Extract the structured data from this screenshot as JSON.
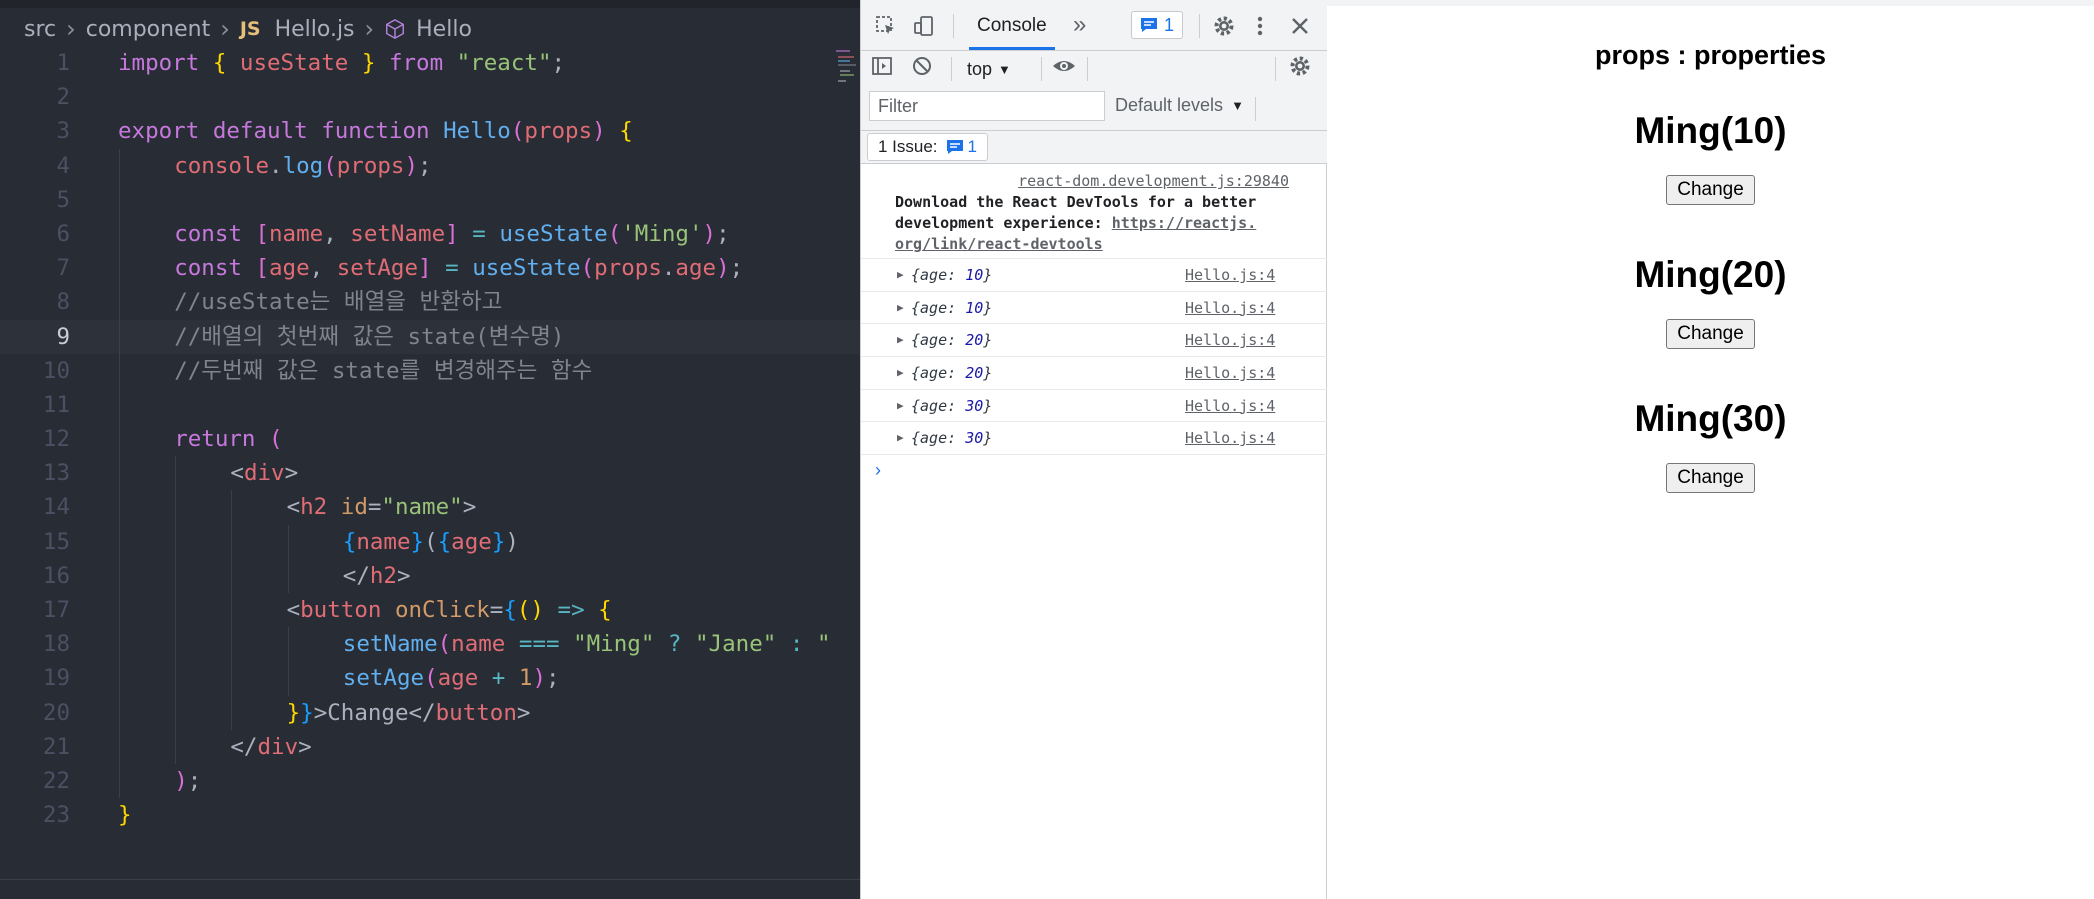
{
  "editor": {
    "breadcrumb": [
      "src",
      "component",
      "Hello.js",
      "Hello"
    ],
    "file_type_badge": "JS",
    "active_line": 9,
    "lines": [
      {
        "n": "1",
        "indent": 0,
        "tokens": [
          [
            "kw",
            "import "
          ],
          [
            "b1",
            "{ "
          ],
          [
            "var",
            "useState"
          ],
          [
            "b1",
            " } "
          ],
          [
            "kw",
            "from "
          ],
          [
            "str",
            "\"react\""
          ],
          [
            "pl",
            ";"
          ]
        ]
      },
      {
        "n": "2",
        "indent": 0,
        "tokens": []
      },
      {
        "n": "3",
        "indent": 0,
        "tokens": [
          [
            "kw",
            "export default function "
          ],
          [
            "fn",
            "Hello"
          ],
          [
            "b2",
            "("
          ],
          [
            "var",
            "props"
          ],
          [
            "b2",
            ")"
          ],
          [
            "b1",
            " {"
          ]
        ]
      },
      {
        "n": "4",
        "indent": 1,
        "tokens": [
          [
            "var",
            "console"
          ],
          [
            "pl",
            "."
          ],
          [
            "fn",
            "log"
          ],
          [
            "b2",
            "("
          ],
          [
            "var",
            "props"
          ],
          [
            "b2",
            ")"
          ],
          [
            "pl",
            ";"
          ]
        ]
      },
      {
        "n": "5",
        "indent": 1,
        "tokens": []
      },
      {
        "n": "6",
        "indent": 1,
        "tokens": [
          [
            "kw",
            "const "
          ],
          [
            "b2",
            "["
          ],
          [
            "var",
            "name"
          ],
          [
            "pl",
            ", "
          ],
          [
            "var",
            "setName"
          ],
          [
            "b2",
            "]"
          ],
          [
            "op",
            " = "
          ],
          [
            "fn",
            "useState"
          ],
          [
            "b2",
            "("
          ],
          [
            "str",
            "'Ming'"
          ],
          [
            "b2",
            ")"
          ],
          [
            "pl",
            ";"
          ]
        ]
      },
      {
        "n": "7",
        "indent": 1,
        "tokens": [
          [
            "kw",
            "const "
          ],
          [
            "b2",
            "["
          ],
          [
            "var",
            "age"
          ],
          [
            "pl",
            ", "
          ],
          [
            "var",
            "setAge"
          ],
          [
            "b2",
            "]"
          ],
          [
            "op",
            " = "
          ],
          [
            "fn",
            "useState"
          ],
          [
            "b2",
            "("
          ],
          [
            "var",
            "props"
          ],
          [
            "pl",
            "."
          ],
          [
            "var",
            "age"
          ],
          [
            "b2",
            ")"
          ],
          [
            "pl",
            ";"
          ]
        ]
      },
      {
        "n": "8",
        "indent": 1,
        "tokens": [
          [
            "cmt",
            "//useState는 배열을 반환하고"
          ]
        ]
      },
      {
        "n": "9",
        "indent": 1,
        "tokens": [
          [
            "cmt",
            "//배열의 첫번째 값은 state(변수명)"
          ]
        ]
      },
      {
        "n": "10",
        "indent": 1,
        "tokens": [
          [
            "cmt",
            "//두번째 값은 state를 변경해주는 함수"
          ]
        ]
      },
      {
        "n": "11",
        "indent": 1,
        "tokens": []
      },
      {
        "n": "12",
        "indent": 1,
        "tokens": [
          [
            "kw",
            "return "
          ],
          [
            "b2",
            "("
          ]
        ]
      },
      {
        "n": "13",
        "indent": 2,
        "tokens": [
          [
            "pl",
            "<"
          ],
          [
            "tag",
            "div"
          ],
          [
            "pl",
            ">"
          ]
        ]
      },
      {
        "n": "14",
        "indent": 3,
        "tokens": [
          [
            "pl",
            "<"
          ],
          [
            "tag",
            "h2 "
          ],
          [
            "attr",
            "id"
          ],
          [
            "pl",
            "="
          ],
          [
            "str",
            "\"name\""
          ],
          [
            "pl",
            ">"
          ]
        ]
      },
      {
        "n": "15",
        "indent": 4,
        "tokens": [
          [
            "b3",
            "{"
          ],
          [
            "var",
            "name"
          ],
          [
            "b3",
            "}"
          ],
          [
            "pl",
            "("
          ],
          [
            "b3",
            "{"
          ],
          [
            "var",
            "age"
          ],
          [
            "b3",
            "}"
          ],
          [
            "pl",
            ")"
          ]
        ]
      },
      {
        "n": "16",
        "indent": 4,
        "tokens": [
          [
            "pl",
            "</"
          ],
          [
            "tag",
            "h2"
          ],
          [
            "pl",
            ">"
          ]
        ]
      },
      {
        "n": "17",
        "indent": 3,
        "tokens": [
          [
            "pl",
            "<"
          ],
          [
            "tag",
            "button "
          ],
          [
            "attr",
            "onClick"
          ],
          [
            "pl",
            "="
          ],
          [
            "b3",
            "{"
          ],
          [
            "b1",
            "()"
          ],
          [
            "op",
            " => "
          ],
          [
            "b1",
            "{"
          ]
        ]
      },
      {
        "n": "18",
        "indent": 4,
        "tokens": [
          [
            "fn",
            "setName"
          ],
          [
            "b2",
            "("
          ],
          [
            "var",
            "name"
          ],
          [
            "op",
            " === "
          ],
          [
            "str",
            "\"Ming\""
          ],
          [
            "op",
            " ? "
          ],
          [
            "str",
            "\"Jane\""
          ],
          [
            "op",
            " : "
          ],
          [
            "str",
            "\""
          ]
        ]
      },
      {
        "n": "19",
        "indent": 4,
        "tokens": [
          [
            "fn",
            "setAge"
          ],
          [
            "b2",
            "("
          ],
          [
            "var",
            "age"
          ],
          [
            "op",
            " + "
          ],
          [
            "num",
            "1"
          ],
          [
            "b2",
            ")"
          ],
          [
            "pl",
            ";"
          ]
        ]
      },
      {
        "n": "20",
        "indent": 3,
        "tokens": [
          [
            "b1",
            "}"
          ],
          [
            "b3",
            "}"
          ],
          [
            "pl",
            ">Change</"
          ],
          [
            "tag",
            "button"
          ],
          [
            "pl",
            ">"
          ]
        ]
      },
      {
        "n": "21",
        "indent": 2,
        "tokens": [
          [
            "pl",
            "</"
          ],
          [
            "tag",
            "div"
          ],
          [
            "pl",
            ">"
          ]
        ]
      },
      {
        "n": "22",
        "indent": 1,
        "tokens": [
          [
            "b2",
            ")"
          ],
          [
            "pl",
            ";"
          ]
        ]
      },
      {
        "n": "23",
        "indent": 0,
        "tokens": [
          [
            "b1",
            "}"
          ]
        ]
      }
    ]
  },
  "devtools": {
    "tab": "Console",
    "issue_badge_count": "1",
    "context": "top",
    "filter_placeholder": "Filter",
    "levels": "Default levels",
    "issues_label": "1 Issue:",
    "issues_count": "1",
    "devtools_msg": {
      "source": "react-dom.development.js:29840",
      "body_line1": "Download the React DevTools for a better",
      "body_line2": "development experience: ",
      "link_part1": "https://reactjs.",
      "link_part2": "org/link/react-devtools"
    },
    "logs": [
      {
        "prefix": "{age: ",
        "value": "10",
        "suffix": "}",
        "source": "Hello.js:4"
      },
      {
        "prefix": "{age: ",
        "value": "10",
        "suffix": "}",
        "source": "Hello.js:4"
      },
      {
        "prefix": "{age: ",
        "value": "20",
        "suffix": "}",
        "source": "Hello.js:4"
      },
      {
        "prefix": "{age: ",
        "value": "20",
        "suffix": "}",
        "source": "Hello.js:4"
      },
      {
        "prefix": "{age: ",
        "value": "30",
        "suffix": "}",
        "source": "Hello.js:4"
      },
      {
        "prefix": "{age: ",
        "value": "30",
        "suffix": "}",
        "source": "Hello.js:4"
      }
    ],
    "prompt": "›"
  },
  "app": {
    "subtitle": "props : properties",
    "hellos": [
      {
        "heading": "Ming(10)",
        "button": "Change"
      },
      {
        "heading": "Ming(20)",
        "button": "Change"
      },
      {
        "heading": "Ming(30)",
        "button": "Change"
      }
    ]
  }
}
